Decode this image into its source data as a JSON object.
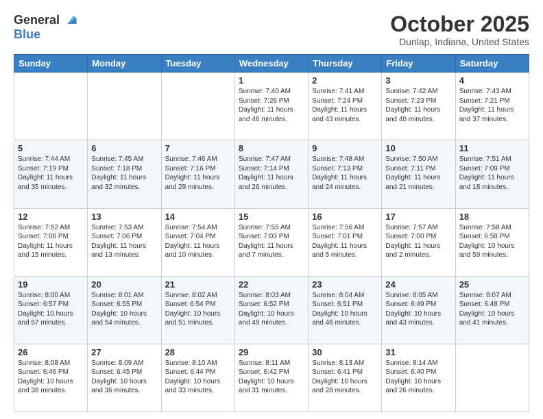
{
  "logo": {
    "general": "General",
    "blue": "Blue"
  },
  "header": {
    "month": "October 2025",
    "location": "Dunlap, Indiana, United States"
  },
  "weekdays": [
    "Sunday",
    "Monday",
    "Tuesday",
    "Wednesday",
    "Thursday",
    "Friday",
    "Saturday"
  ],
  "weeks": [
    [
      {
        "day": "",
        "info": ""
      },
      {
        "day": "",
        "info": ""
      },
      {
        "day": "",
        "info": ""
      },
      {
        "day": "1",
        "info": "Sunrise: 7:40 AM\nSunset: 7:26 PM\nDaylight: 11 hours and 46 minutes."
      },
      {
        "day": "2",
        "info": "Sunrise: 7:41 AM\nSunset: 7:24 PM\nDaylight: 11 hours and 43 minutes."
      },
      {
        "day": "3",
        "info": "Sunrise: 7:42 AM\nSunset: 7:23 PM\nDaylight: 11 hours and 40 minutes."
      },
      {
        "day": "4",
        "info": "Sunrise: 7:43 AM\nSunset: 7:21 PM\nDaylight: 11 hours and 37 minutes."
      }
    ],
    [
      {
        "day": "5",
        "info": "Sunrise: 7:44 AM\nSunset: 7:19 PM\nDaylight: 11 hours and 35 minutes."
      },
      {
        "day": "6",
        "info": "Sunrise: 7:45 AM\nSunset: 7:18 PM\nDaylight: 11 hours and 32 minutes."
      },
      {
        "day": "7",
        "info": "Sunrise: 7:46 AM\nSunset: 7:16 PM\nDaylight: 11 hours and 29 minutes."
      },
      {
        "day": "8",
        "info": "Sunrise: 7:47 AM\nSunset: 7:14 PM\nDaylight: 11 hours and 26 minutes."
      },
      {
        "day": "9",
        "info": "Sunrise: 7:48 AM\nSunset: 7:13 PM\nDaylight: 11 hours and 24 minutes."
      },
      {
        "day": "10",
        "info": "Sunrise: 7:50 AM\nSunset: 7:11 PM\nDaylight: 11 hours and 21 minutes."
      },
      {
        "day": "11",
        "info": "Sunrise: 7:51 AM\nSunset: 7:09 PM\nDaylight: 11 hours and 18 minutes."
      }
    ],
    [
      {
        "day": "12",
        "info": "Sunrise: 7:52 AM\nSunset: 7:08 PM\nDaylight: 11 hours and 15 minutes."
      },
      {
        "day": "13",
        "info": "Sunrise: 7:53 AM\nSunset: 7:06 PM\nDaylight: 11 hours and 13 minutes."
      },
      {
        "day": "14",
        "info": "Sunrise: 7:54 AM\nSunset: 7:04 PM\nDaylight: 11 hours and 10 minutes."
      },
      {
        "day": "15",
        "info": "Sunrise: 7:55 AM\nSunset: 7:03 PM\nDaylight: 11 hours and 7 minutes."
      },
      {
        "day": "16",
        "info": "Sunrise: 7:56 AM\nSunset: 7:01 PM\nDaylight: 11 hours and 5 minutes."
      },
      {
        "day": "17",
        "info": "Sunrise: 7:57 AM\nSunset: 7:00 PM\nDaylight: 11 hours and 2 minutes."
      },
      {
        "day": "18",
        "info": "Sunrise: 7:58 AM\nSunset: 6:58 PM\nDaylight: 10 hours and 59 minutes."
      }
    ],
    [
      {
        "day": "19",
        "info": "Sunrise: 8:00 AM\nSunset: 6:57 PM\nDaylight: 10 hours and 57 minutes."
      },
      {
        "day": "20",
        "info": "Sunrise: 8:01 AM\nSunset: 6:55 PM\nDaylight: 10 hours and 54 minutes."
      },
      {
        "day": "21",
        "info": "Sunrise: 8:02 AM\nSunset: 6:54 PM\nDaylight: 10 hours and 51 minutes."
      },
      {
        "day": "22",
        "info": "Sunrise: 8:03 AM\nSunset: 6:52 PM\nDaylight: 10 hours and 49 minutes."
      },
      {
        "day": "23",
        "info": "Sunrise: 8:04 AM\nSunset: 6:51 PM\nDaylight: 10 hours and 46 minutes."
      },
      {
        "day": "24",
        "info": "Sunrise: 8:05 AM\nSunset: 6:49 PM\nDaylight: 10 hours and 43 minutes."
      },
      {
        "day": "25",
        "info": "Sunrise: 8:07 AM\nSunset: 6:48 PM\nDaylight: 10 hours and 41 minutes."
      }
    ],
    [
      {
        "day": "26",
        "info": "Sunrise: 8:08 AM\nSunset: 6:46 PM\nDaylight: 10 hours and 38 minutes."
      },
      {
        "day": "27",
        "info": "Sunrise: 8:09 AM\nSunset: 6:45 PM\nDaylight: 10 hours and 36 minutes."
      },
      {
        "day": "28",
        "info": "Sunrise: 8:10 AM\nSunset: 6:44 PM\nDaylight: 10 hours and 33 minutes."
      },
      {
        "day": "29",
        "info": "Sunrise: 8:11 AM\nSunset: 6:42 PM\nDaylight: 10 hours and 31 minutes."
      },
      {
        "day": "30",
        "info": "Sunrise: 8:13 AM\nSunset: 6:41 PM\nDaylight: 10 hours and 28 minutes."
      },
      {
        "day": "31",
        "info": "Sunrise: 8:14 AM\nSunset: 6:40 PM\nDaylight: 10 hours and 26 minutes."
      },
      {
        "day": "",
        "info": ""
      }
    ]
  ]
}
